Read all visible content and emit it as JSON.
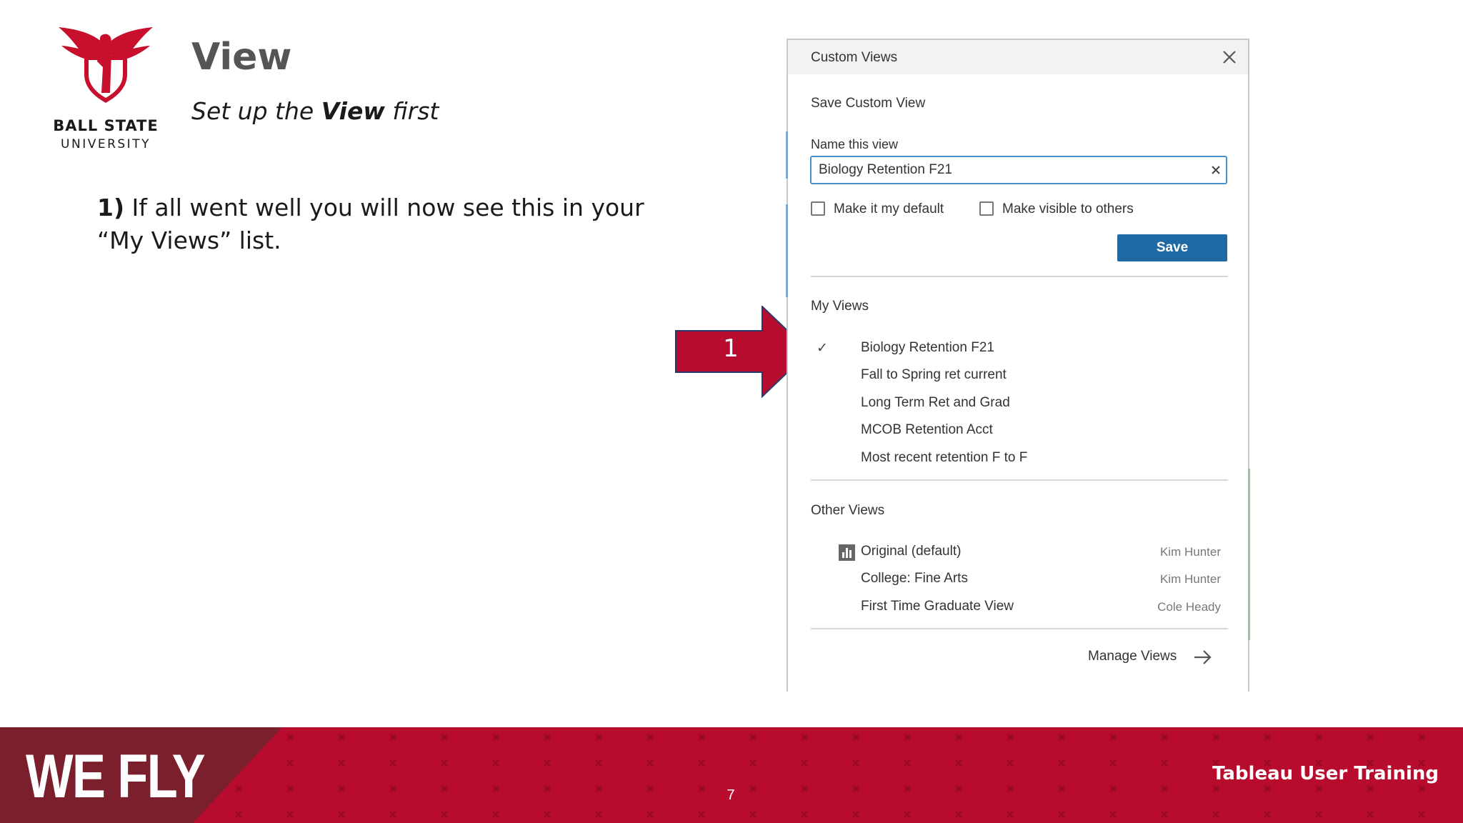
{
  "slide": {
    "title": "View",
    "subtitle_pre": "Set up the ",
    "subtitle_bold": "View",
    "subtitle_post": " first",
    "step_num": "1)",
    "step_text": " If all went well you will now see this in your “My Views” list.",
    "arrow_label": "1"
  },
  "logo": {
    "line1": "BALL STATE",
    "line2": "UNIVERSITY",
    "color": "#c8102e"
  },
  "dialog": {
    "title": "Custom Views",
    "save_section": "Save Custom View",
    "name_label": "Name this view",
    "name_value": "Biology Retention F21",
    "make_default_label": "Make it my default",
    "make_default_checked": false,
    "visible_label": "Make visible to others",
    "visible_checked": false,
    "save_label": "Save",
    "my_views_heading": "My Views",
    "my_views": [
      {
        "name": "Biology Retention F21",
        "selected": true
      },
      {
        "name": "Fall to Spring ret current",
        "selected": false
      },
      {
        "name": "Long Term Ret and Grad",
        "selected": false
      },
      {
        "name": "MCOB Retention Acct",
        "selected": false
      },
      {
        "name": "Most recent retention F to F",
        "selected": false
      }
    ],
    "other_views_heading": "Other Views",
    "other_views": [
      {
        "name": "Original (default)",
        "owner": "Kim Hunter"
      },
      {
        "name": "College: Fine Arts",
        "owner": "Kim Hunter"
      },
      {
        "name": "First Time Graduate View",
        "owner": "Cole Heady"
      }
    ],
    "manage_label": "Manage Views",
    "accent": "#1f6aa5"
  },
  "footer": {
    "brand": "WE FLY",
    "page_number": "7",
    "right_text": "Tableau User Training",
    "color": "#b80c2f"
  }
}
